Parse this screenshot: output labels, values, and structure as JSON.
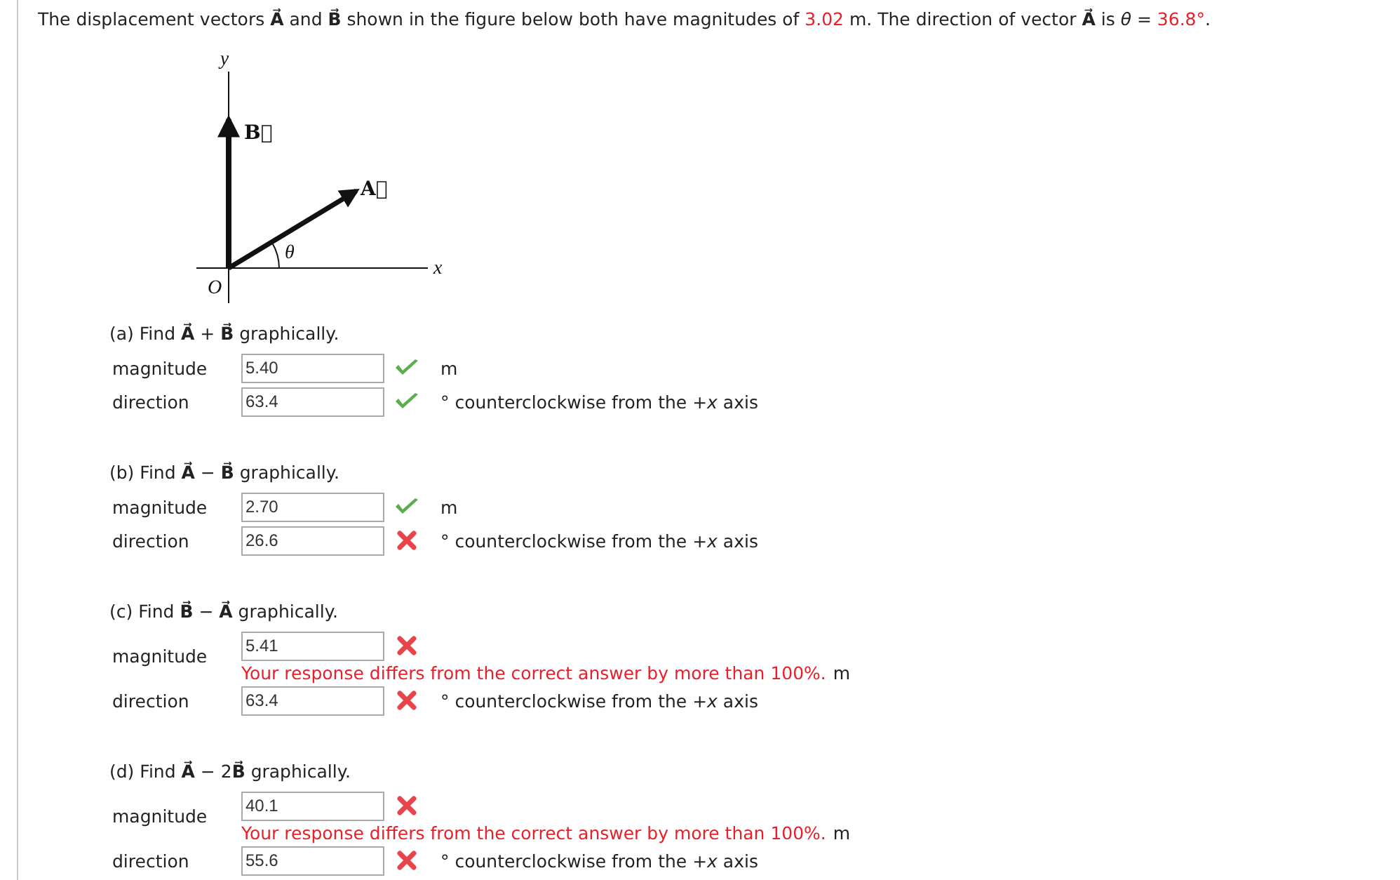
{
  "intro": [
    {
      "kind": "text",
      "text": "The displacement vectors **A⃗** and **B⃗** shown in the figure below both have magnitudes of "
    },
    {
      "kind": "value",
      "text": "3.02"
    },
    {
      "kind": "text",
      "text": " m. The direction of vector **A⃗** is *θ* = "
    },
    {
      "kind": "value",
      "text": "36.8°"
    },
    {
      "kind": "text",
      "text": "."
    }
  ],
  "figure": {
    "y_label": "y",
    "x_label": "x",
    "origin_label": "O",
    "angle_label": "θ",
    "vector_b_label": "B⃗",
    "vector_a_label": "A⃗"
  },
  "parts": [
    {
      "title": "(a) Find **A⃗** + **B⃗** graphically.",
      "rows": [
        {
          "label": "magnitude",
          "value": "5.40",
          "correct": true,
          "unit": "m"
        },
        {
          "label": "direction",
          "value": "63.4",
          "correct": true,
          "unit": "° counterclockwise from the +*x* axis"
        }
      ]
    },
    {
      "title": "(b) Find **A⃗** − **B⃗** graphically.",
      "rows": [
        {
          "label": "magnitude",
          "value": "2.70",
          "correct": true,
          "unit": "m"
        },
        {
          "label": "direction",
          "value": "26.6",
          "correct": false,
          "unit": "° counterclockwise from the +*x* axis"
        }
      ]
    },
    {
      "title": "(c) Find **B⃗** − **A⃗** graphically.",
      "rows": [
        {
          "label": "magnitude",
          "value": "5.41",
          "correct": false,
          "feedback": "Your response differs from the correct answer by more than 100%.",
          "unit": "m"
        },
        {
          "label": "direction",
          "value": "63.4",
          "correct": false,
          "unit": "° counterclockwise from the +*x* axis"
        }
      ]
    },
    {
      "title": "(d) Find **A⃗** − 2**B⃗** graphically.",
      "rows": [
        {
          "label": "magnitude",
          "value": "40.1",
          "correct": false,
          "feedback": "Your response differs from the correct answer by more than 100%.",
          "unit": "m"
        },
        {
          "label": "direction",
          "value": "55.6",
          "correct": false,
          "unit": "° counterclockwise from the +*x* axis"
        }
      ]
    }
  ]
}
